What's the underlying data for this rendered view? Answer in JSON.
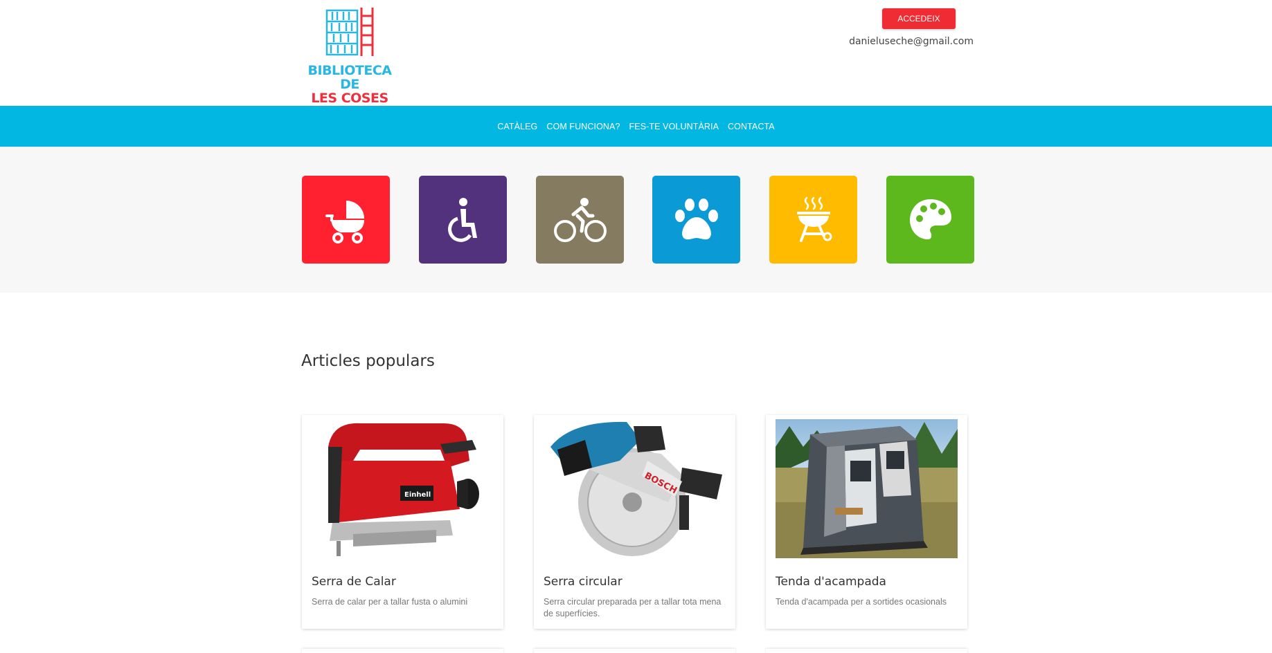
{
  "header": {
    "logo": {
      "line1": "BIBLIOTECA DE",
      "line2": "LES COSES",
      "colors": {
        "primary": "#29b6e0",
        "accent": "#ef2f3c"
      }
    },
    "login_label": "ACCEDEIX",
    "user_email": "danieluseche@gmail.com"
  },
  "nav": {
    "items": [
      {
        "label": "CATÀLEG"
      },
      {
        "label": "COM FUNCIONA?"
      },
      {
        "label": "FES-TE VOLUNTÀRIA"
      },
      {
        "label": "CONTACTA"
      }
    ],
    "background": "#02b8e3"
  },
  "categories": [
    {
      "icon": "baby-stroller-icon",
      "color": "#ff2130"
    },
    {
      "icon": "wheelchair-icon",
      "color": "#52327d"
    },
    {
      "icon": "bicycle-icon",
      "color": "#847b60"
    },
    {
      "icon": "paw-icon",
      "color": "#0a9ad5"
    },
    {
      "icon": "barbecue-grill-icon",
      "color": "#ffbb00"
    },
    {
      "icon": "paint-palette-icon",
      "color": "#5cb81c"
    }
  ],
  "popular": {
    "title": "Articles populars",
    "items": [
      {
        "title": "Serra de Calar",
        "description": "Serra de calar per a tallar fusta o alumini",
        "image": "jigsaw-image"
      },
      {
        "title": "Serra circular",
        "description": "Serra circular preparada per a tallar tota mena de superfícies.",
        "image": "circular-saw-image"
      },
      {
        "title": "Tenda d'acampada",
        "description": "Tenda d'acampada per a sortides ocasionals",
        "image": "camping-tent-image"
      }
    ]
  }
}
